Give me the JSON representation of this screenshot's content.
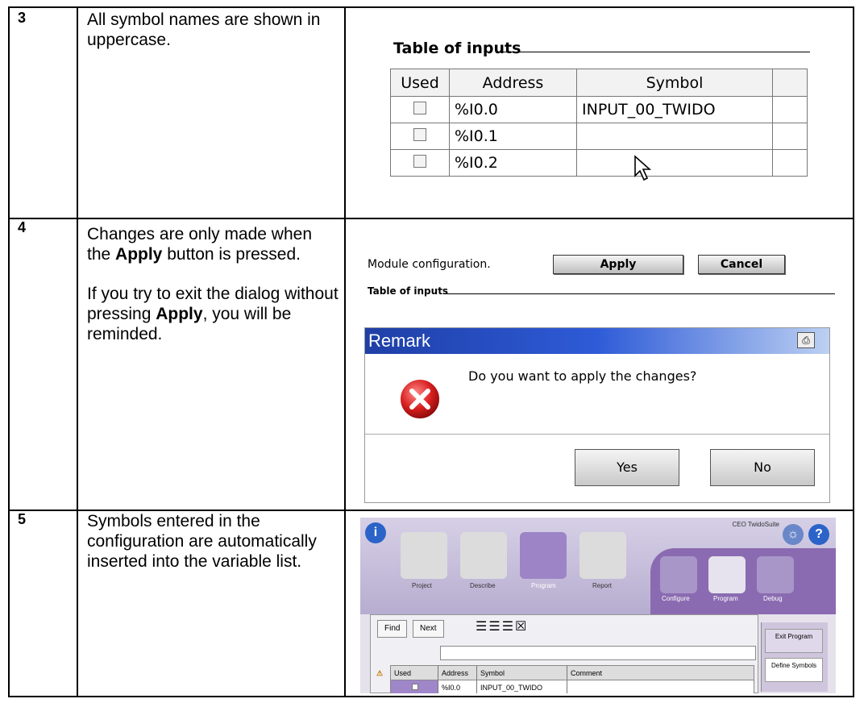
{
  "steps": [
    {
      "number": "3",
      "text": "All symbol names are shown in uppercase."
    },
    {
      "number": "4",
      "paragraphs": [
        [
          "Changes are only made when the ",
          "Apply",
          " button is pressed."
        ],
        [
          "If you try to exit the dialog without pressing ",
          "Apply",
          ", you will be reminded."
        ]
      ]
    },
    {
      "number": "5",
      "text": "Symbols entered in the configuration are automatically inserted into the variable list."
    }
  ],
  "inputs_table": {
    "title": "Table of inputs",
    "columns": [
      "Used",
      "Address",
      "Symbol"
    ],
    "rows": [
      {
        "used": false,
        "address": "%I0.0",
        "symbol": "INPUT_00_TWIDO"
      },
      {
        "used": false,
        "address": "%I0.1",
        "symbol": ""
      },
      {
        "used": false,
        "address": "%I0.2",
        "symbol": ""
      }
    ]
  },
  "module_config": {
    "label": "Module configuration.",
    "apply_label": "Apply",
    "cancel_label": "Cancel",
    "table_label": "Table of inputs"
  },
  "remark_dialog": {
    "title": "Remark",
    "message": "Do you want to apply the changes?",
    "yes_label": "Yes",
    "no_label": "No"
  },
  "app": {
    "brand": "CEO TwidoSuite",
    "tabs": [
      "Project",
      "Describe",
      "Program",
      "Report"
    ],
    "right_tabs": [
      "Configure",
      "Program",
      "Debug"
    ],
    "find_label": "Find",
    "next_label": "Next",
    "side_items": [
      "Exit Program",
      "Define Symbols"
    ],
    "columns": [
      "Used",
      "Address",
      "Symbol",
      "Comment"
    ],
    "row": {
      "address": "%I0.0",
      "symbol": "INPUT_00_TWIDO",
      "comment": ""
    }
  }
}
